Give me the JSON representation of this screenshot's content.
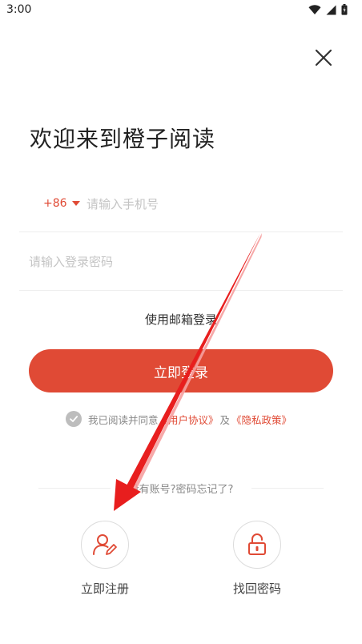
{
  "status_bar": {
    "time": "3:00",
    "icons": [
      "wifi-icon",
      "signal-icon",
      "battery-icon"
    ]
  },
  "header": {
    "close_icon": "close-icon"
  },
  "welcome": {
    "title": "欢迎来到橙子阅读"
  },
  "form": {
    "country_code": "+86",
    "phone_placeholder": "请输入手机号",
    "password_placeholder": "请输入登录密码",
    "email_login": "使用邮箱登录",
    "login_button": "立即登录"
  },
  "agreement": {
    "prefix": "我已阅读并同意",
    "user_agreement": "《用户协议》",
    "and": "及",
    "privacy_policy": "《隐私政策》"
  },
  "divider": {
    "text": "没有账号?密码忘记了?"
  },
  "actions": {
    "register_label": "立即注册",
    "register_icon": "user-edit-icon",
    "recover_label": "找回密码",
    "recover_icon": "unlock-icon"
  },
  "colors": {
    "accent": "#e04a35",
    "muted": "#888888",
    "divider": "#eeeeee",
    "arrow": "#e81e1e"
  }
}
